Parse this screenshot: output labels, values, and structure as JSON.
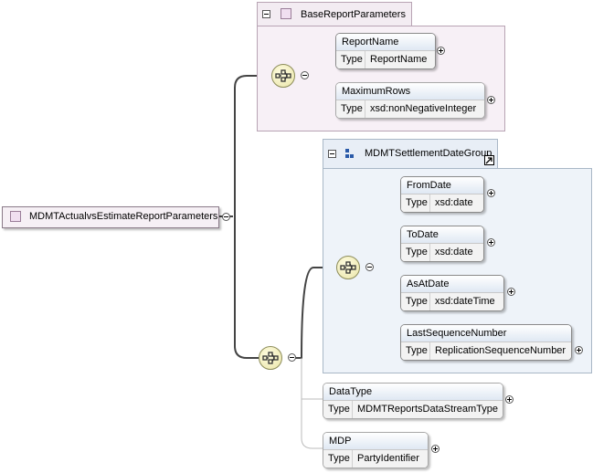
{
  "root": {
    "name": "MDMTActualvsEstimateReportParameters"
  },
  "base_group": {
    "title": "BaseReportParameters",
    "elements": [
      {
        "name": "ReportName",
        "type_label": "Type",
        "type": "ReportName"
      },
      {
        "name": "MaximumRows",
        "type_label": "Type",
        "type": "xsd:nonNegativeInteger"
      }
    ]
  },
  "settlement_group": {
    "title": "MDMTSettlementDateGroup",
    "elements": [
      {
        "name": "FromDate",
        "type_label": "Type",
        "type": "xsd:date"
      },
      {
        "name": "ToDate",
        "type_label": "Type",
        "type": "xsd:date"
      },
      {
        "name": "AsAtDate",
        "type_label": "Type",
        "type": "xsd:dateTime"
      },
      {
        "name": "LastSequenceNumber",
        "type_label": "Type",
        "type": "ReplicationSequenceNumber"
      }
    ]
  },
  "outer_elements": [
    {
      "name": "DataType",
      "type_label": "Type",
      "type": "MDMTReportsDataStreamType"
    },
    {
      "name": "MDP",
      "type_label": "Type",
      "type": "PartyIdentifier"
    }
  ],
  "icons": {
    "sequence": "sequence-compositor-icon",
    "group_ref": "group-reference-icon",
    "expand": "expand-plus-icon",
    "collapse": "collapse-minus-icon",
    "link": "link-arrow-icon"
  },
  "colors": {
    "base_group_bg": "#f7f0f6",
    "settlement_group_bg": "#eef3f9",
    "element_header": "#dfe8f3",
    "sequence_fill": "#e9e4a8"
  }
}
